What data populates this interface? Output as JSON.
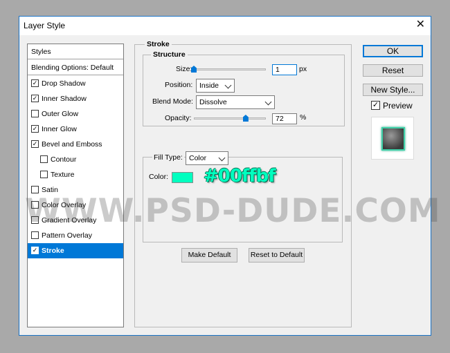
{
  "window": {
    "title": "Layer Style",
    "close_glyph": "✕"
  },
  "styles_list": {
    "header": "Styles",
    "blending": "Blending Options: Default",
    "items": [
      {
        "label": "Drop Shadow",
        "checked": true
      },
      {
        "label": "Inner Shadow",
        "checked": true
      },
      {
        "label": "Outer Glow",
        "checked": false
      },
      {
        "label": "Inner Glow",
        "checked": true
      },
      {
        "label": "Bevel and Emboss",
        "checked": true
      },
      {
        "label": "Contour",
        "checked": false
      },
      {
        "label": "Texture",
        "checked": false
      },
      {
        "label": "Satin",
        "checked": false
      },
      {
        "label": "Color Overlay",
        "checked": false
      },
      {
        "label": "Gradient Overlay",
        "checked": false
      },
      {
        "label": "Pattern Overlay",
        "checked": false
      },
      {
        "label": "Stroke",
        "checked": true,
        "selected": true
      }
    ],
    "check_glyph": "✓"
  },
  "stroke": {
    "section_title": "Stroke",
    "structure_title": "Structure",
    "size_label": "Size:",
    "size_value": "1",
    "size_unit": "px",
    "size_slider_fraction": 0.0,
    "position_label": "Position:",
    "position_value": "Inside",
    "blend_mode_label": "Blend Mode:",
    "blend_mode_value": "Dissolve",
    "opacity_label": "Opacity:",
    "opacity_value": "72",
    "opacity_unit": "%",
    "opacity_fraction": 0.72,
    "fill_type_label": "Fill Type:",
    "fill_type_value": "Color",
    "color_label": "Color:",
    "color_hex": "#00ffbf",
    "color_annotation": "#00ffbf",
    "make_default": "Make Default",
    "reset_default": "Reset to Default"
  },
  "actions": {
    "ok": "OK",
    "reset": "Reset",
    "new_style": "New Style...",
    "preview_label": "Preview",
    "preview_checked": true
  },
  "watermark": "WWW.PSD-DUDE.COM",
  "colors": {
    "accent": "#0078d7",
    "swatch": "#00ffbf"
  },
  "icons": {
    "dropdown": "chevron-down-icon",
    "close": "close-icon",
    "checkbox": "check-icon"
  }
}
